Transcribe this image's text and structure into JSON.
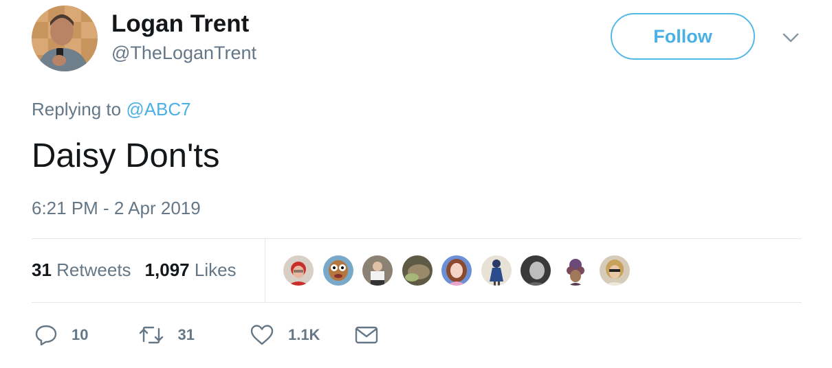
{
  "author": {
    "name": "Logan Trent",
    "handle": "@TheLoganTrent"
  },
  "follow_label": "Follow",
  "reply": {
    "prefix": "Replying to",
    "mention": "@ABC7"
  },
  "tweet_text": "Daisy Don'ts",
  "timestamp": "6:21 PM - 2 Apr 2019",
  "stats": {
    "retweets_count": "31",
    "retweets_label": "Retweets",
    "likes_count": "1,097",
    "likes_label": "Likes"
  },
  "liker_avatar_count": 9,
  "actions": {
    "replies": "10",
    "retweets": "31",
    "likes": "1.1K"
  },
  "icons": [
    "chevron-down-icon",
    "reply-icon",
    "retweet-icon",
    "heart-icon",
    "message-icon"
  ],
  "colors": {
    "accent": "#4ab0e6",
    "secondary_text": "#657786",
    "primary_text": "#14171a",
    "divider": "#e1e8ed"
  }
}
